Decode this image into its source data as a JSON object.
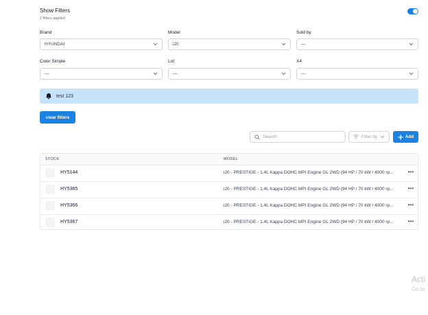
{
  "header": {
    "title": "Show Filters",
    "subtitle": "2 filters applied",
    "toggle_on": true
  },
  "filters": {
    "brand": {
      "label": "Brand",
      "value": "HYUNDAI"
    },
    "model": {
      "label": "Model",
      "value": "i20"
    },
    "sold_by": {
      "label": "Sold by",
      "value": "—"
    },
    "color_simple": {
      "label": "Color Simple",
      "value": "—"
    },
    "lot": {
      "label": "Lot",
      "value": "—"
    },
    "x4": {
      "label": "X4",
      "value": "—"
    }
  },
  "alert": {
    "icon": "bell-icon",
    "text": "test 123"
  },
  "actions": {
    "clear_label": "clear filters",
    "search_placeholder": "Search",
    "filter_by_label": "Filter by",
    "add_label": "Add"
  },
  "table": {
    "columns": [
      "STOCK",
      "MODEL"
    ],
    "rows": [
      {
        "stock": "HY5144",
        "model": "i20 - PRESTIGE - 1.4L Kappa DOHC MPI Engine GL 2WD (94 HP / 70 kW / 4000 rp..."
      },
      {
        "stock": "HY5365",
        "model": "i20 - PRESTIGE - 1.4L Kappa DOHC MPI Engine GL 2WD (94 HP / 70 kW / 4000 rp..."
      },
      {
        "stock": "HY5366",
        "model": "i20 - PRESTIGE - 1.4L Kappa DOHC MPI Engine GL 2WD (94 HP / 70 kW / 4000 rp..."
      },
      {
        "stock": "HY5367",
        "model": "i20 - PRESTIGE - 1.4L Kappa DOHC MPI Engine GL 2WD (94 HP / 70 kW / 4000 rp..."
      }
    ],
    "row_menu": "•••"
  },
  "os_watermark": {
    "line1": "Acti",
    "line2": "Go to"
  },
  "colors": {
    "accent": "#1a82e2",
    "alert_bg": "#c7e3fa"
  }
}
